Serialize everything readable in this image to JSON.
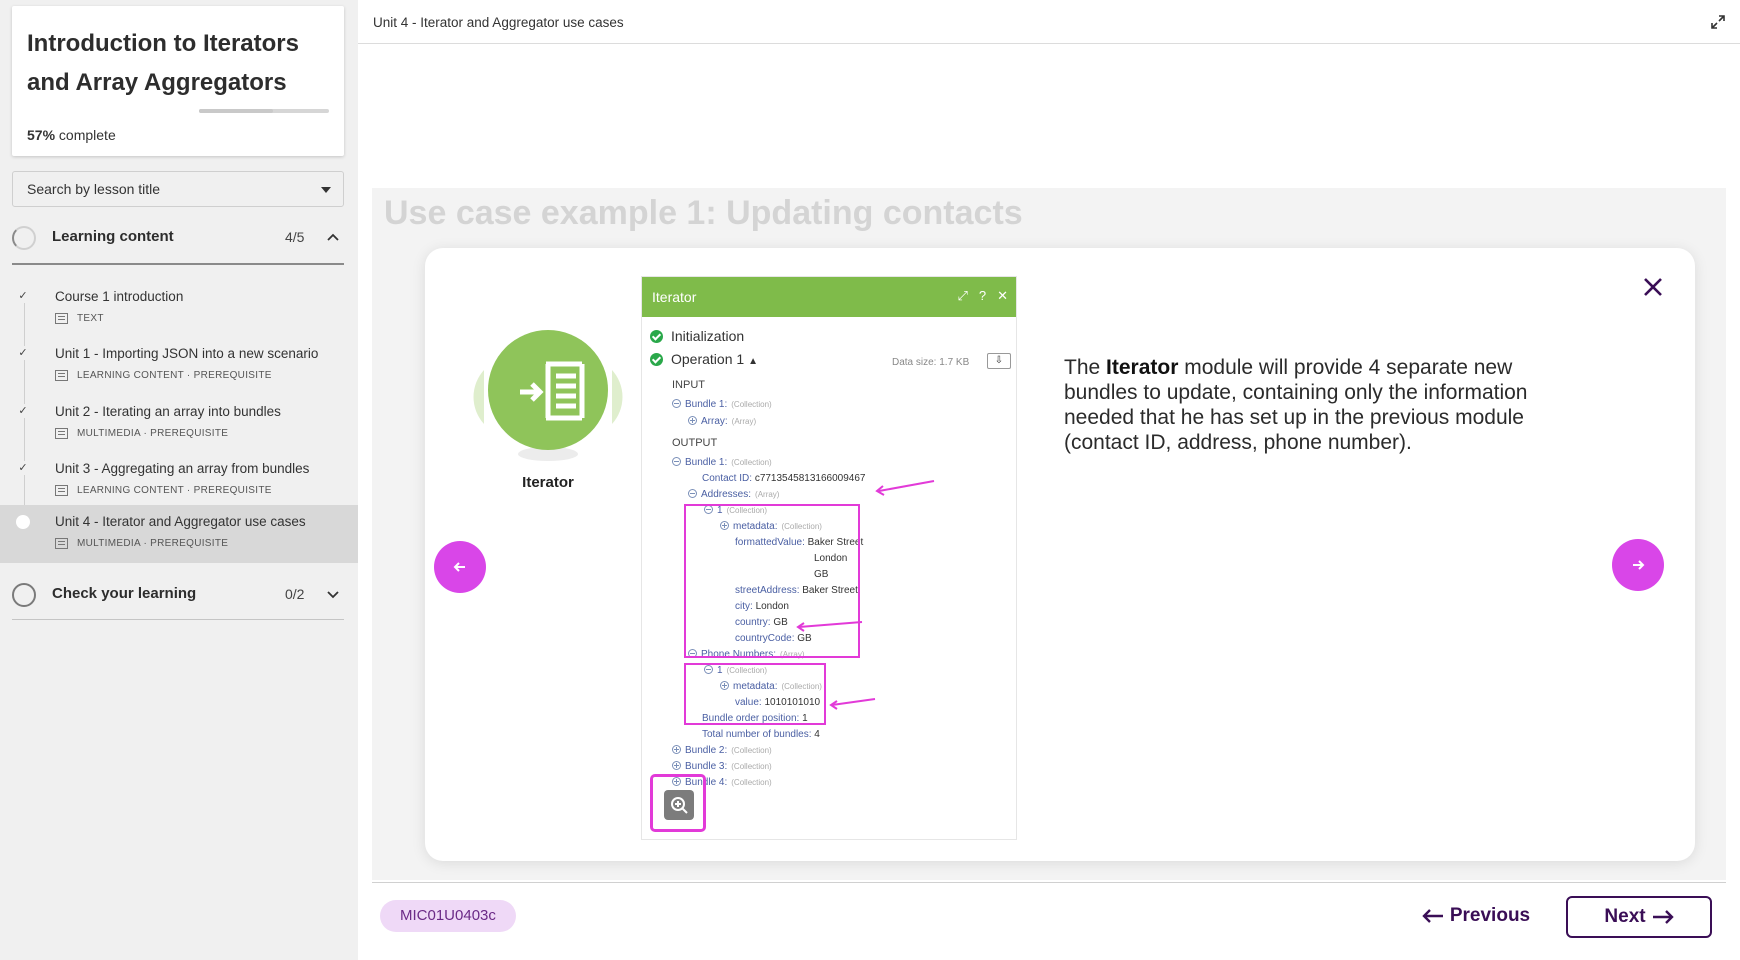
{
  "sidebar": {
    "course_title": "Introduction to Iterators and Array Aggregators",
    "progress_percent": "57%",
    "progress_word": "complete",
    "progress_value": 57,
    "search_placeholder": "Search by lesson title",
    "sections": [
      {
        "label": "Learning content",
        "count": "4/5"
      },
      {
        "label": "Check your learning",
        "count": "0/2"
      }
    ],
    "lessons": [
      {
        "title": "Course 1 introduction",
        "meta": "TEXT"
      },
      {
        "title": "Unit 1 - Importing JSON into a new scenario",
        "meta": "LEARNING CONTENT · PREREQUISITE"
      },
      {
        "title": "Unit 2 - Iterating an array into bundles",
        "meta": "MULTIMEDIA · PREREQUISITE"
      },
      {
        "title": "Unit 3 - Aggregating an array from bundles",
        "meta": "LEARNING CONTENT · PREREQUISITE"
      },
      {
        "title": "Unit 4 - Iterator and Aggregator use cases",
        "meta": "MULTIMEDIA · PREREQUISITE"
      }
    ]
  },
  "header": {
    "breadcrumb": "Unit 4 - Iterator and Aggregator use cases"
  },
  "slide": {
    "heading": "Use case example 1: Updating contacts",
    "module_label": "Iterator",
    "desc_pre": "The ",
    "desc_bold": "Iterator",
    "desc_post": " module will provide 4 separate new bundles to update, containing only the information needed that he has set up in the previous module (contact ID, address, phone number)."
  },
  "panel": {
    "title": "Iterator",
    "initialization": "Initialization",
    "operation": "Operation 1",
    "data_size": "Data size: 1.7 KB",
    "input": "INPUT",
    "output": "OUTPUT",
    "collection": "(Collection)",
    "array": "(Array)",
    "bundle1": "Bundle 1:",
    "array_key": "Array:",
    "contact_id_key": "Contact ID:",
    "contact_id_val": "c7713545813166009467",
    "addresses": "Addresses:",
    "one": "1",
    "metadata": "metadata:",
    "formatted_key": "formattedValue:",
    "formatted_v1": "Baker Street",
    "formatted_v2": "London",
    "formatted_v3": "GB",
    "street_key": "streetAddress:",
    "street_val": "Baker Street",
    "city_key": "city:",
    "city_val": "London",
    "country_key": "country:",
    "country_val": "GB",
    "countrycode_key": "countryCode:",
    "countrycode_val": "GB",
    "phones": "Phone Numbers:",
    "value_key": "value:",
    "value_val": "1010101010",
    "order_key": "Bundle order position:",
    "order_val": "1",
    "total_key": "Total number of bundles:",
    "total_val": "4",
    "bundle2": "Bundle 2:",
    "bundle3": "Bundle 3:",
    "bundle4": "Bundle 4:"
  },
  "footer": {
    "code": "MIC01U0403c",
    "previous": "Previous",
    "next": "Next"
  },
  "colors": {
    "accent_magenta": "#d946e8",
    "brand_purple": "#3a0e56",
    "iterator_green": "#7fbb4a",
    "highlight": "#e23ad8"
  }
}
